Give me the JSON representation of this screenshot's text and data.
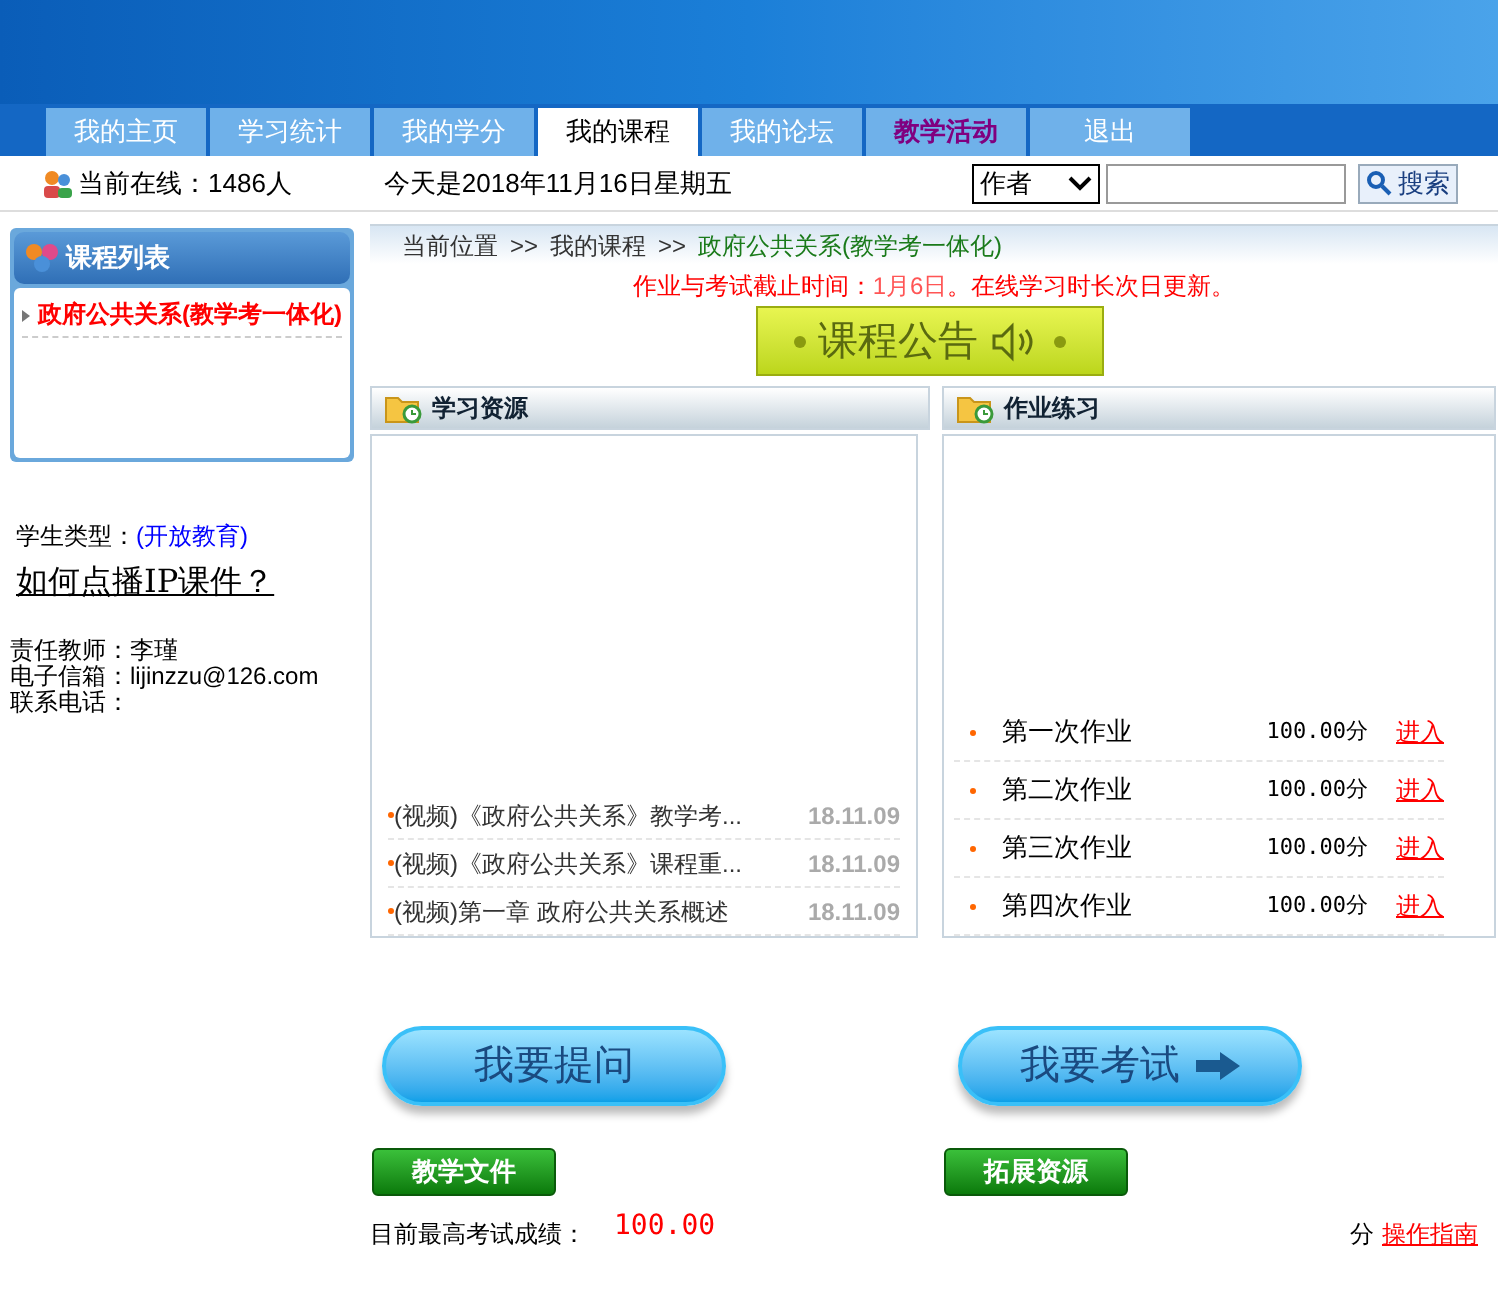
{
  "tabs": [
    {
      "label": "我的主页",
      "selected": false,
      "emphasized": false
    },
    {
      "label": "学习统计",
      "selected": false,
      "emphasized": false
    },
    {
      "label": "我的学分",
      "selected": false,
      "emphasized": false
    },
    {
      "label": "我的课程",
      "selected": true,
      "emphasized": false
    },
    {
      "label": "我的论坛",
      "selected": false,
      "emphasized": false
    },
    {
      "label": "教学活动",
      "selected": false,
      "emphasized": true
    },
    {
      "label": "退出",
      "selected": false,
      "emphasized": false
    }
  ],
  "info_bar": {
    "online": "当前在线：1486人",
    "date": "今天是2018年11月16日星期五",
    "search_scope": "作者",
    "search_button": "搜索"
  },
  "sidebar": {
    "title": "课程列表",
    "courses": [
      "政府公共关系(教学考一体化)"
    ],
    "student_type_label": "学生类型：",
    "student_type": "(开放教育)",
    "help_link": "如何点播IP课件？",
    "teacher": "责任教师：李瑾",
    "email": "电子信箱：lijinzzu@126.com",
    "phone": "联系电话："
  },
  "breadcrumb": [
    "当前位置",
    ">>",
    "我的课程",
    ">>",
    "政府公共关系(教学考一体化)"
  ],
  "notice": {
    "before": "作业与考试截止时间：",
    "date": "1月6日",
    "after": "。在线学习时长次日更新。"
  },
  "announcement_button": "课程公告",
  "resources": {
    "title": "学习资源",
    "items": [
      {
        "title": "(视频)《政府公共关系》教学考...",
        "date": "18.11.09"
      },
      {
        "title": "(视频)《政府公共关系》课程重...",
        "date": "18.11.09"
      },
      {
        "title": "(视频)第一章 政府公共关系概述",
        "date": "18.11.09"
      }
    ]
  },
  "homework": {
    "title": "作业练习",
    "items": [
      {
        "title": "第一次作业",
        "score": "100.00分",
        "link": "进入"
      },
      {
        "title": "第二次作业",
        "score": "100.00分",
        "link": "进入"
      },
      {
        "title": "第三次作业",
        "score": "100.00分",
        "link": "进入"
      },
      {
        "title": "第四次作业",
        "score": "100.00分",
        "link": "进入"
      }
    ]
  },
  "ask_button": "我要提问",
  "exam_button": "我要考试",
  "docs_button": "教学文件",
  "extra_button": "拓展资源",
  "score": {
    "label": "目前最高考试成绩：",
    "value": "100.00",
    "unit": "分",
    "guide_link": "操作指南"
  }
}
